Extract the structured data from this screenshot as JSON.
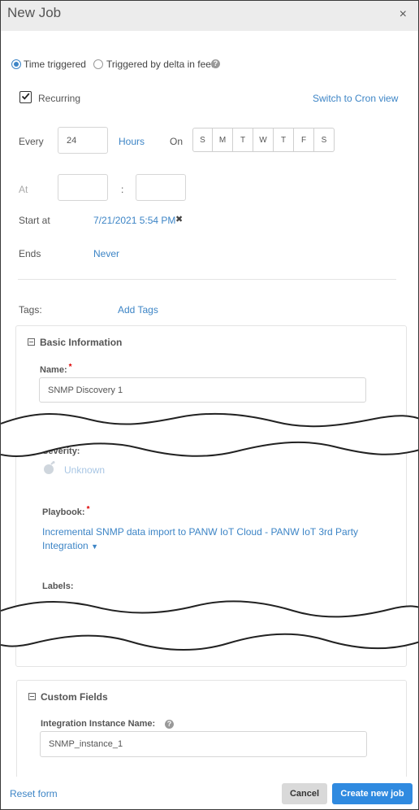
{
  "header": {
    "title": "New Job",
    "close_glyph": "×"
  },
  "trigger": {
    "option_time": "Time triggered",
    "option_delta": "Triggered by delta in feed",
    "selected": "Time triggered"
  },
  "recurring": {
    "label": "Recurring",
    "checked": true,
    "switch_link": "Switch to Cron view"
  },
  "every": {
    "label": "Every",
    "value": "24",
    "unit": "Hours",
    "on_label": "On",
    "days": [
      "S",
      "M",
      "T",
      "W",
      "T",
      "F",
      "S"
    ]
  },
  "at": {
    "label": "At",
    "hour": "",
    "minute": "",
    "separator": ":"
  },
  "start": {
    "label": "Start at",
    "value": "7/21/2021 5:54 PM",
    "clear_glyph": "✖"
  },
  "ends": {
    "label": "Ends",
    "value": "Never"
  },
  "tags": {
    "label": "Tags:",
    "add_link": "Add Tags"
  },
  "basic": {
    "title": "Basic Information",
    "name_label": "Name:",
    "name_value": "SNMP Discovery 1",
    "severity_label": "Severity:",
    "severity_value": "Unknown",
    "playbook_label": "Playbook:",
    "playbook_line1": "Incremental SNMP data import to PANW IoT Cloud - PANW IoT 3rd Party",
    "playbook_line2": "Integration",
    "labels_label": "Labels:"
  },
  "custom": {
    "title": "Custom Fields",
    "instance_label": "Integration Instance Name:",
    "instance_value": "SNMP_instance_1"
  },
  "footer": {
    "reset": "Reset form",
    "cancel": "Cancel",
    "create": "Create new job"
  },
  "colors": {
    "accent": "#3d85c6",
    "header_bg": "#ececec",
    "primary_btn": "#2f8ae0",
    "cancel_btn": "#d9d9d9"
  }
}
